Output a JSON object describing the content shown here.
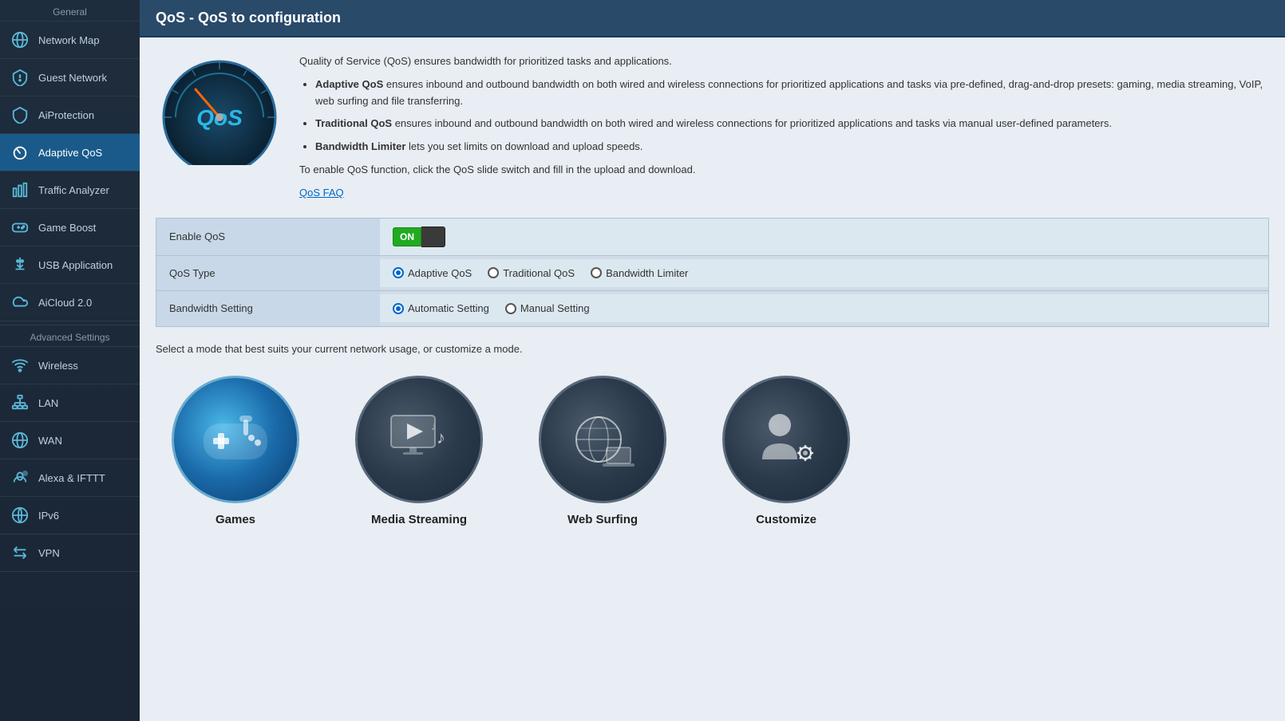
{
  "sidebar": {
    "general_label": "General",
    "items": [
      {
        "id": "network-map",
        "label": "Network Map",
        "icon": "globe"
      },
      {
        "id": "guest-network",
        "label": "Guest Network",
        "icon": "shield-dashed"
      },
      {
        "id": "aiprotection",
        "label": "AiProtection",
        "icon": "shield"
      },
      {
        "id": "adaptive-qos",
        "label": "Adaptive QoS",
        "icon": "speedometer",
        "active": true
      },
      {
        "id": "traffic-analyzer",
        "label": "Traffic Analyzer",
        "icon": "bar-chart"
      },
      {
        "id": "game-boost",
        "label": "Game Boost",
        "icon": "gamepad"
      },
      {
        "id": "usb-application",
        "label": "USB Application",
        "icon": "usb"
      },
      {
        "id": "aicloud",
        "label": "AiCloud 2.0",
        "icon": "cloud"
      }
    ],
    "advanced_label": "Advanced Settings",
    "advanced_items": [
      {
        "id": "wireless",
        "label": "Wireless",
        "icon": "wifi"
      },
      {
        "id": "lan",
        "label": "LAN",
        "icon": "lan"
      },
      {
        "id": "wan",
        "label": "WAN",
        "icon": "globe2"
      },
      {
        "id": "alexa-ifttt",
        "label": "Alexa & IFTTT",
        "icon": "alexa"
      },
      {
        "id": "ipv6",
        "label": "IPv6",
        "icon": "globe3"
      },
      {
        "id": "vpn",
        "label": "VPN",
        "icon": "arrows"
      }
    ]
  },
  "page": {
    "title": "QoS - QoS to configuration",
    "intro": "Quality of Service (QoS) ensures bandwidth for prioritized tasks and applications.",
    "bullets": [
      {
        "bold": "Adaptive QoS",
        "text": " ensures inbound and outbound bandwidth on both wired and wireless connections for prioritized applications and tasks via pre-defined, drag-and-drop presets: gaming, media streaming, VoIP, web surfing and file transferring."
      },
      {
        "bold": "Traditional QoS",
        "text": " ensures inbound and outbound bandwidth on both wired and wireless connections for prioritized applications and tasks via manual user-defined parameters."
      },
      {
        "bold": "Bandwidth Limiter",
        "text": " lets you set limits on download and upload speeds."
      }
    ],
    "enable_note": "To enable QoS function, click the QoS slide switch and fill in the upload and download.",
    "faq_label": "QoS FAQ",
    "settings": {
      "enable_qos_label": "Enable QoS",
      "enable_qos_value": "ON",
      "qos_type_label": "QoS Type",
      "qos_type_options": [
        "Adaptive QoS",
        "Traditional QoS",
        "Bandwidth Limiter"
      ],
      "qos_type_selected": "Adaptive QoS",
      "bandwidth_label": "Bandwidth Setting",
      "bandwidth_options": [
        "Automatic Setting",
        "Manual Setting"
      ],
      "bandwidth_selected": "Automatic Setting"
    },
    "mode_prompt": "Select a mode that best suits your current network usage, or customize a mode.",
    "modes": [
      {
        "id": "games",
        "label": "Games"
      },
      {
        "id": "media-streaming",
        "label": "Media Streaming"
      },
      {
        "id": "web-surfing",
        "label": "Web Surfing"
      },
      {
        "id": "customize",
        "label": "Customize"
      }
    ]
  }
}
